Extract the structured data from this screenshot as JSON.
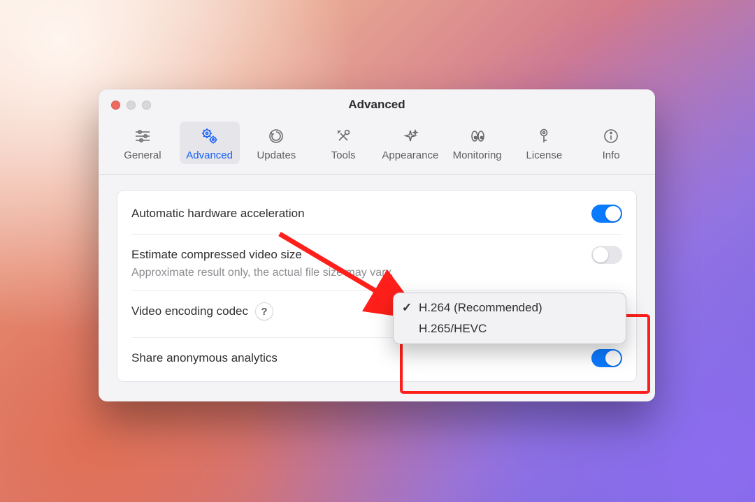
{
  "window": {
    "title": "Advanced"
  },
  "toolbar": {
    "tabs": [
      {
        "id": "general",
        "label": "General",
        "active": false
      },
      {
        "id": "advanced",
        "label": "Advanced",
        "active": true
      },
      {
        "id": "updates",
        "label": "Updates",
        "active": false
      },
      {
        "id": "tools",
        "label": "Tools",
        "active": false
      },
      {
        "id": "appearance",
        "label": "Appearance",
        "active": false
      },
      {
        "id": "monitoring",
        "label": "Monitoring",
        "active": false
      },
      {
        "id": "license",
        "label": "License",
        "active": false
      },
      {
        "id": "info",
        "label": "Info",
        "active": false
      }
    ]
  },
  "settings": {
    "hw_accel": {
      "label": "Automatic hardware acceleration",
      "value": true
    },
    "estimate_size": {
      "label": "Estimate compressed video size",
      "description": "Approximate result only, the actual file size may vary.",
      "value": false
    },
    "codec": {
      "label": "Video encoding codec",
      "help_symbol": "?",
      "selected": "H.264 (Recommended)",
      "options": [
        "H.264 (Recommended)",
        "H.265/HEVC"
      ]
    },
    "analytics": {
      "label": "Share anonymous analytics",
      "value": true
    }
  },
  "annotation": {
    "type": "arrow-and-box",
    "color": "#ff1f1a"
  }
}
